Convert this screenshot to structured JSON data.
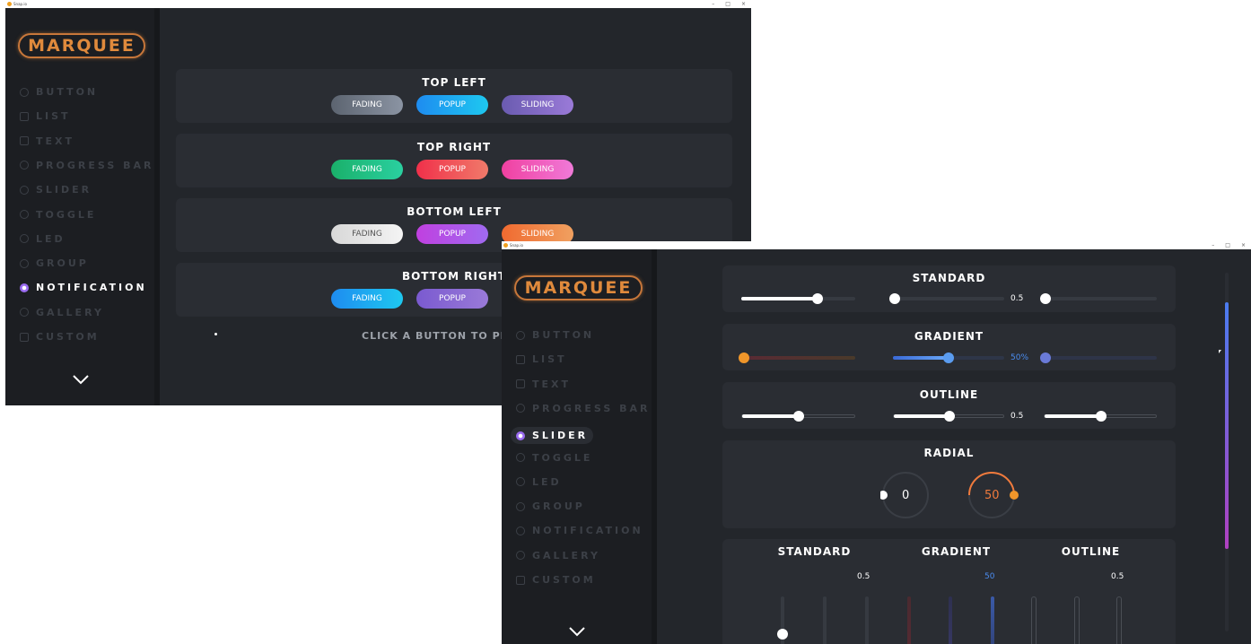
{
  "window1": {
    "title": "Snap.io",
    "logo": "MARQUEE",
    "nav": [
      {
        "label": "BUTTON",
        "icon": "radio-icon",
        "active": false
      },
      {
        "label": "LIST",
        "icon": "checkbox-icon",
        "active": false
      },
      {
        "label": "TEXT",
        "icon": "text-box-icon",
        "active": false
      },
      {
        "label": "PROGRESS BAR",
        "icon": "progress-icon",
        "active": false
      },
      {
        "label": "SLIDER",
        "icon": "slider-icon",
        "active": false
      },
      {
        "label": "TOGGLE",
        "icon": "toggle-icon",
        "active": false
      },
      {
        "label": "LED",
        "icon": "led-icon",
        "active": false
      },
      {
        "label": "GROUP",
        "icon": "group-icon",
        "active": false
      },
      {
        "label": "NOTIFICATION",
        "icon": "notification-icon",
        "active": true
      },
      {
        "label": "GALLERY",
        "icon": "gallery-icon",
        "active": false
      },
      {
        "label": "CUSTOM",
        "icon": "custom-icon",
        "active": false
      }
    ],
    "sections": [
      {
        "title": "TOP LEFT",
        "buttons": [
          {
            "label": "FADING",
            "from": "#5c6470",
            "to": "#8b94a3"
          },
          {
            "label": "POPUP",
            "from": "#1e8cf0",
            "to": "#1ec8f0"
          },
          {
            "label": "SLIDING",
            "from": "#6a5bb0",
            "to": "#9a7ad8"
          }
        ]
      },
      {
        "title": "TOP RIGHT",
        "buttons": [
          {
            "label": "FADING",
            "from": "#1ab06a",
            "to": "#2ad0a0"
          },
          {
            "label": "POPUP",
            "from": "#f0304a",
            "to": "#f07a6a"
          },
          {
            "label": "SLIDING",
            "from": "#f040a0",
            "to": "#f07ad8"
          }
        ]
      },
      {
        "title": "BOTTOM LEFT",
        "buttons": [
          {
            "label": "FADING",
            "from": "#d8d8d8",
            "to": "#f4f4f4",
            "dark": true
          },
          {
            "label": "POPUP",
            "from": "#c040e0",
            "to": "#a06af0"
          },
          {
            "label": "SLIDING",
            "from": "#f06a30",
            "to": "#f0a060"
          }
        ]
      },
      {
        "title": "BOTTOM RIGHT",
        "buttons": [
          {
            "label": "FADING",
            "from": "#1e8cf0",
            "to": "#1ec8f0"
          },
          {
            "label": "POPUP",
            "from": "#7a5ad0",
            "to": "#9a7ad8"
          },
          {
            "label": "",
            "from": "#888",
            "to": "#aaa"
          }
        ]
      }
    ],
    "message": "CLICK A BUTTON TO PI"
  },
  "window2": {
    "title": "Snap.io",
    "logo": "MARQUEE",
    "nav": [
      {
        "label": "BUTTON",
        "icon": "radio-icon",
        "active": false
      },
      {
        "label": "LIST",
        "icon": "checkbox-icon",
        "active": false
      },
      {
        "label": "TEXT",
        "icon": "text-box-icon",
        "active": false
      },
      {
        "label": "PROGRESS BAR",
        "icon": "progress-icon",
        "active": false
      },
      {
        "label": "SLIDER",
        "icon": "slider-icon",
        "active": true
      },
      {
        "label": "TOGGLE",
        "icon": "toggle-icon",
        "active": false
      },
      {
        "label": "LED",
        "icon": "led-icon",
        "active": false
      },
      {
        "label": "GROUP",
        "icon": "group-icon",
        "active": false
      },
      {
        "label": "NOTIFICATION",
        "icon": "notification-icon",
        "active": false
      },
      {
        "label": "GALLERY",
        "icon": "gallery-icon",
        "active": false
      },
      {
        "label": "CUSTOM",
        "icon": "custom-icon",
        "active": false
      }
    ],
    "standard": {
      "title": "STANDARD",
      "values": [
        0.7,
        0.0,
        0.0
      ],
      "label": "0.5"
    },
    "gradient": {
      "title": "GRADIENT",
      "values": [
        0.0,
        0.5,
        0.0
      ],
      "label": "50%"
    },
    "outline": {
      "title": "OUTLINE",
      "values": [
        0.5,
        0.5,
        0.5
      ],
      "label": "0.5"
    },
    "radial": {
      "title": "RADIAL",
      "left_value": "0",
      "right_value": "50"
    },
    "vertical": {
      "standard": {
        "title": "STANDARD",
        "label": "0.5"
      },
      "gradient": {
        "title": "GRADIENT",
        "label": "50"
      },
      "outline": {
        "title": "OUTLINE",
        "label": "0.5"
      }
    },
    "colors": {
      "accent": "#4a8cf0",
      "orange": "#f0962a",
      "radial_orange": "#f07a3c"
    }
  }
}
